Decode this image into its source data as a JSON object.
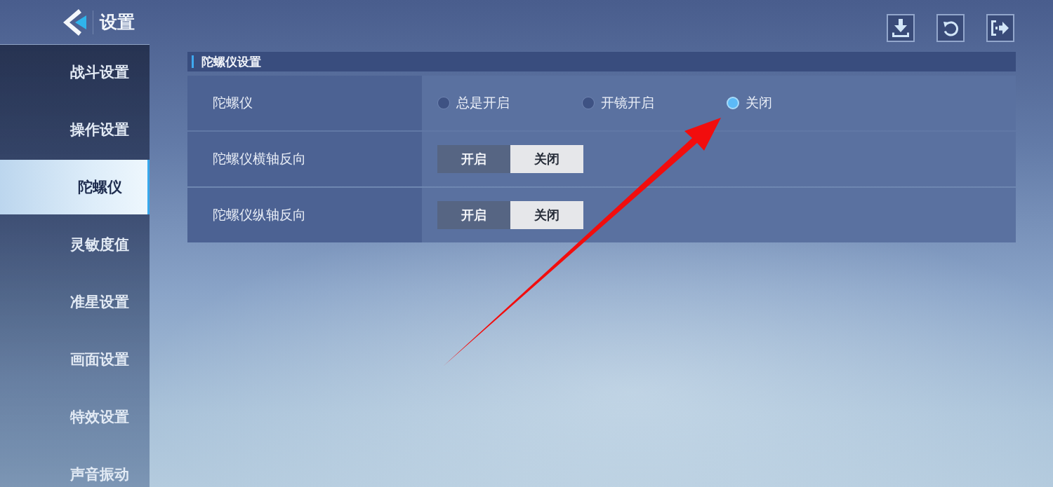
{
  "header": {
    "title": "设置"
  },
  "sidebar": {
    "items": [
      {
        "label": "战斗设置",
        "selected": false
      },
      {
        "label": "操作设置",
        "selected": false
      },
      {
        "label": "陀螺仪",
        "selected": true
      },
      {
        "label": "灵敏度值",
        "selected": false
      },
      {
        "label": "准星设置",
        "selected": false
      },
      {
        "label": "画面设置",
        "selected": false
      },
      {
        "label": "特效设置",
        "selected": false
      },
      {
        "label": "声音振动",
        "selected": false
      }
    ]
  },
  "section": {
    "title": "陀螺仪设置",
    "rows": [
      {
        "kind": "radio",
        "label": "陀螺仪",
        "options": [
          {
            "label": "总是开启",
            "selected": false
          },
          {
            "label": "开镜开启",
            "selected": false
          },
          {
            "label": "关闭",
            "selected": true
          }
        ]
      },
      {
        "kind": "toggle",
        "label": "陀螺仪横轴反向",
        "options": [
          {
            "label": "开启",
            "selected": false
          },
          {
            "label": "关闭",
            "selected": true
          }
        ]
      },
      {
        "kind": "toggle",
        "label": "陀螺仪纵轴反向",
        "options": [
          {
            "label": "开启",
            "selected": false
          },
          {
            "label": "关闭",
            "selected": true
          }
        ]
      }
    ]
  }
}
